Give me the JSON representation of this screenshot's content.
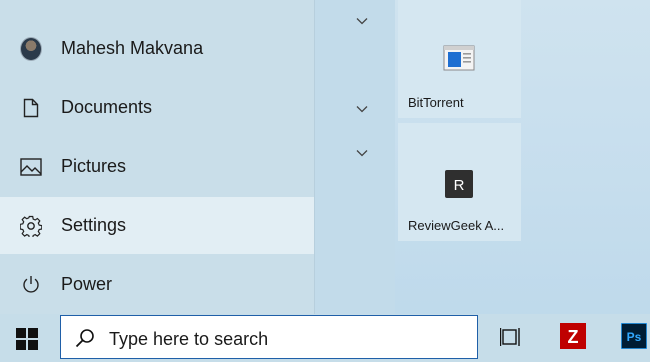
{
  "start_menu": {
    "items": [
      {
        "label": "Mahesh Makvana",
        "icon": "user-avatar-icon"
      },
      {
        "label": "Documents",
        "icon": "document-icon"
      },
      {
        "label": "Pictures",
        "icon": "pictures-icon"
      },
      {
        "label": "Settings",
        "icon": "gear-icon"
      },
      {
        "label": "Power",
        "icon": "power-icon"
      }
    ],
    "active_item": "Settings"
  },
  "tiles": [
    {
      "label": "BitTorrent",
      "icon": "bittorrent-icon"
    },
    {
      "label": "ReviewGeek A...",
      "icon": "reviewgeek-icon",
      "icon_letter": "R"
    }
  ],
  "taskbar": {
    "search_placeholder": "Type here to search",
    "apps": [
      {
        "name": "FileZilla",
        "glyph": "Z",
        "color": "#bf0000"
      },
      {
        "name": "Photoshop",
        "glyph": "Ps",
        "color": "#001d34"
      }
    ]
  },
  "colors": {
    "accent": "#1f5fa8",
    "menu_bg": "#c9dee9",
    "highlight": "#e2eef4"
  }
}
